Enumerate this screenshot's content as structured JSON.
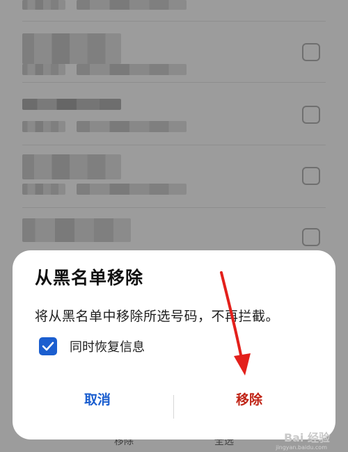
{
  "dialog": {
    "title": "从黑名单移除",
    "message": "将从黑名单中移除所选号码，不再拦截。",
    "checkbox_label": "同时恢复信息",
    "checkbox_checked": true,
    "cancel_label": "取消",
    "confirm_label": "移除"
  },
  "bottom_bar": {
    "remove_label": "移除",
    "select_all_label": "全选"
  },
  "watermark": {
    "text": "Bai 经验",
    "sub": "jingyan.baidu.com"
  },
  "colors": {
    "accent_blue": "#1b5ecf",
    "danger_red": "#c02416",
    "arrow_red": "#e3201b"
  }
}
